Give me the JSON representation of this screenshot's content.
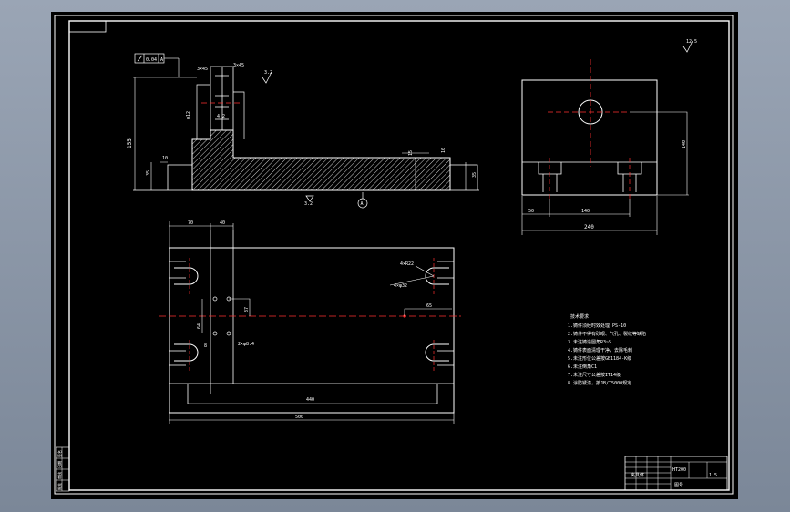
{
  "colors": {
    "background": "#000000",
    "line": "#ffffff",
    "centerline": "#ff3030",
    "frame": "#ffffff"
  },
  "front_view": {
    "datum_label": "A",
    "tolerance_frame": [
      "0.04",
      "A"
    ],
    "dims": {
      "overall_height": "155",
      "base_height": "35",
      "left_step": "10",
      "right_step_height": "35",
      "right_step": "15",
      "right_small": "10",
      "top_left": "3×45",
      "top_right": "3×45",
      "counterbore": "φ12",
      "slot_depth": "4.2"
    },
    "roughness": [
      "3.2",
      "6.3",
      "3.2"
    ]
  },
  "side_view": {
    "dims": {
      "width": "240",
      "left": "50",
      "center": "140",
      "height": "140"
    },
    "roughness": "12.5"
  },
  "plan_view": {
    "dims": {
      "width": "500",
      "inner_width": "440",
      "left_offset": "70",
      "slot_width": "40",
      "hole_spacing": "64",
      "small": "8",
      "hole_offset": "37",
      "right_offset": "65",
      "holes_label": "2×φ8.4",
      "slot_label_1": "4×R22",
      "slot_label_2": "4×φ32"
    }
  },
  "technical_notes": {
    "heading": "技术要求",
    "lines": [
      "1.铸件须经时效处理 PS-10",
      "2.铸件不得有砂眼、气孔、裂纹等缺陷",
      "3.未注铸造圆角R3~5",
      "4.铸件表面清理干净，去除毛刺",
      "5.未注形位公差按GB1184-K级",
      "6.未注倒角C1",
      "7.未注尺寸公差按IT14级",
      "8.涂防锈漆，按JB/T5000规定"
    ]
  },
  "title_block": {
    "part_name": "夹具体",
    "material": "HT200",
    "scale": "1:5",
    "sheet": "图号"
  },
  "left_strip": [
    "签名",
    "日期",
    "审核",
    "批准"
  ]
}
